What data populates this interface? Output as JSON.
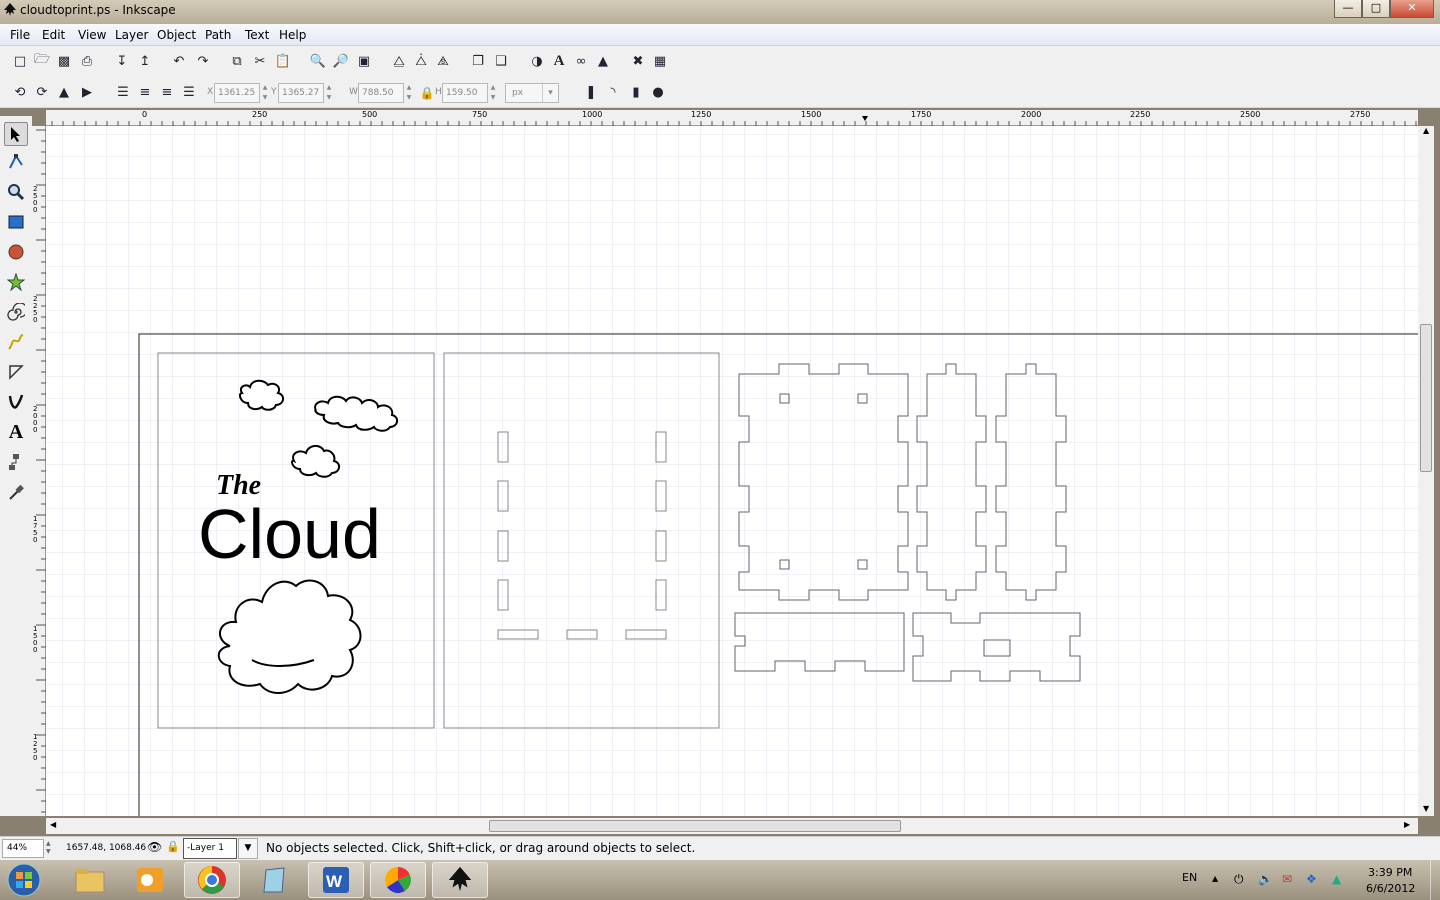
{
  "window": {
    "title": "cloudtoprint.ps - Inkscape"
  },
  "menu": [
    "File",
    "Edit",
    "View",
    "Layer",
    "Object",
    "Path",
    "Text",
    "Help"
  ],
  "toolbar": {
    "x_label": "X",
    "x_value": "1361.25",
    "y_label": "Y",
    "y_value": "1365.27",
    "w_label": "W",
    "w_value": "788.50",
    "h_label": "H",
    "h_value": "159.50",
    "unit": "px"
  },
  "ruler": {
    "h_ticks": [
      "0",
      "250",
      "500",
      "750",
      "1000",
      "1250",
      "1500",
      "1750",
      "2000",
      "2250",
      "2500",
      "2750"
    ],
    "v_ticks": [
      "2500",
      "2250",
      "2000",
      "1750",
      "1500",
      "1250"
    ]
  },
  "artwork": {
    "text_the": "The",
    "text_cloud": "Cloud"
  },
  "status": {
    "zoom": "44%",
    "coords": "1657.48, 1068.46",
    "layer": "-Layer 1",
    "message": "No objects selected. Click, Shift+click, or drag around objects to select."
  },
  "tray": {
    "lang": "EN",
    "time": "3:39 PM",
    "date": "6/6/2012"
  },
  "colors": {
    "accent": "#1f5fb0",
    "canvas_bg": "#ffffff",
    "grid": "#e2e2f2"
  }
}
